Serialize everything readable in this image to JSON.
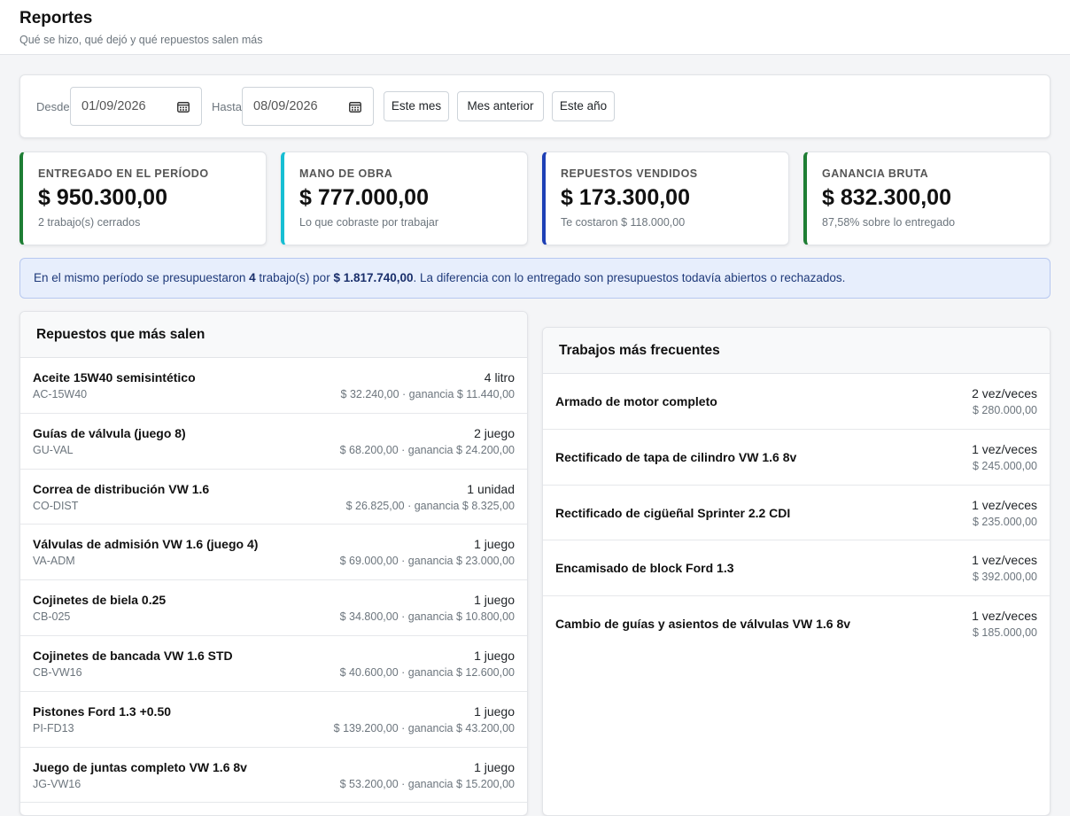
{
  "header": {
    "title": "Reportes",
    "subtitle": "Qué se hizo, qué dejó y qué repuestos salen más"
  },
  "filters": {
    "desde_label": "Desde",
    "desde_value": "01/09/2026",
    "hasta_label": "Hasta",
    "hasta_value": "08/09/2026",
    "btn_este_mes": "Este mes",
    "btn_mes_anterior": "Mes anterior",
    "btn_este_anio": "Este año",
    "calendar_icon": "calendar-icon"
  },
  "stats": [
    {
      "label": "Entregado en el período",
      "value": "$ 950.300,00",
      "sub": "2 trabajo(s) cerrados",
      "color": "#1e7e34"
    },
    {
      "label": "Mano de obra",
      "value": "$ 777.000,00",
      "sub": "Lo que cobraste por trabajar",
      "color": "#17bed3"
    },
    {
      "label": "Repuestos vendidos",
      "value": "$ 173.300,00",
      "sub": "Te costaron $ 118.000,00",
      "color": "#1d3fb5"
    },
    {
      "label": "Ganancia bruta",
      "value": "$ 832.300,00",
      "sub": "87,58% sobre lo entregado",
      "color": "#1e7e34"
    }
  ],
  "banner": {
    "t1": "En el mismo período se presupuestaron ",
    "count": "4",
    "t2": " trabajo(s) por ",
    "amount": "$ 1.817.740,00",
    "t3": ". La diferencia con lo entregado son presupuestos todavía abiertos o rechazados."
  },
  "parts_panel": {
    "title": "Repuestos que más salen",
    "items": [
      {
        "name": "Aceite 15W40 semisintético",
        "code": "AC-15W40",
        "qty": "4 litro",
        "money": "$ 32.240,00 · ganancia $ 11.440,00"
      },
      {
        "name": "Guías de válvula (juego 8)",
        "code": "GU-VAL",
        "qty": "2 juego",
        "money": "$ 68.200,00 · ganancia $ 24.200,00"
      },
      {
        "name": "Correa de distribución VW 1.6",
        "code": "CO-DIST",
        "qty": "1 unidad",
        "money": "$ 26.825,00 · ganancia $ 8.325,00"
      },
      {
        "name": "Válvulas de admisión VW 1.6 (juego 4)",
        "code": "VA-ADM",
        "qty": "1 juego",
        "money": "$ 69.000,00 · ganancia $ 23.000,00"
      },
      {
        "name": "Cojinetes de biela 0.25",
        "code": "CB-025",
        "qty": "1 juego",
        "money": "$ 34.800,00 · ganancia $ 10.800,00"
      },
      {
        "name": "Cojinetes de bancada VW 1.6 STD",
        "code": "CB-VW16",
        "qty": "1 juego",
        "money": "$ 40.600,00 · ganancia $ 12.600,00"
      },
      {
        "name": "Pistones Ford 1.3 +0.50",
        "code": "PI-FD13",
        "qty": "1 juego",
        "money": "$ 139.200,00 · ganancia $ 43.200,00"
      },
      {
        "name": "Juego de juntas completo VW 1.6 8v",
        "code": "JG-VW16",
        "qty": "1 juego",
        "money": "$ 53.200,00 · ganancia $ 15.200,00"
      }
    ]
  },
  "jobs_panel": {
    "title": "Trabajos más frecuentes",
    "items": [
      {
        "name": "Armado de motor completo",
        "count": "2 vez/veces",
        "money": "$ 280.000,00"
      },
      {
        "name": "Rectificado de tapa de cilindro VW 1.6 8v",
        "count": "1 vez/veces",
        "money": "$ 245.000,00"
      },
      {
        "name": "Rectificado de cigüeñal Sprinter 2.2 CDI",
        "count": "1 vez/veces",
        "money": "$ 235.000,00"
      },
      {
        "name": "Encamisado de block Ford 1.3",
        "count": "1 vez/veces",
        "money": "$ 392.000,00"
      },
      {
        "name": "Cambio de guías y asientos de válvulas VW 1.6 8v",
        "count": "1 vez/veces",
        "money": "$ 185.000,00"
      }
    ]
  }
}
